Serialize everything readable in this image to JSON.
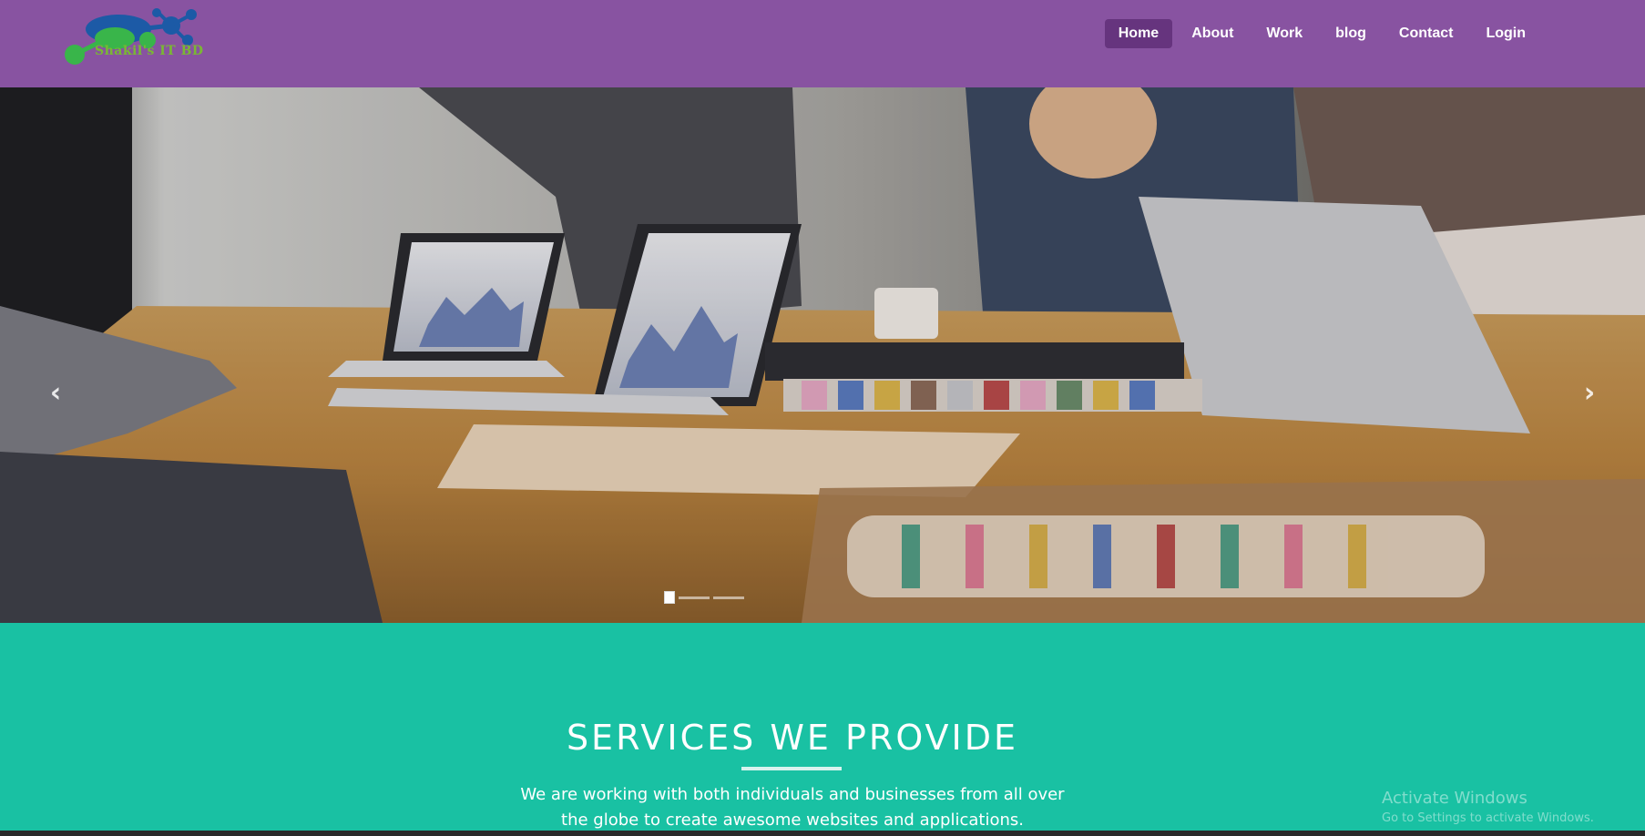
{
  "brand": {
    "logo_text": "Shakil's IT BD"
  },
  "nav": {
    "items": [
      {
        "label": "Home",
        "active": true
      },
      {
        "label": "About",
        "active": false
      },
      {
        "label": "Work",
        "active": false
      },
      {
        "label": "blog",
        "active": false
      },
      {
        "label": "Contact",
        "active": false
      },
      {
        "label": "Login",
        "active": false
      }
    ]
  },
  "carousel": {
    "prev_icon": "chevron-left-icon",
    "next_icon": "chevron-right-icon",
    "slide_count": 3,
    "active_slide": 1
  },
  "services": {
    "title": "SERVICES WE PROVIDE",
    "description": "We are working with both individuals and businesses from all over the globe to create awesome websites and applications."
  },
  "watermark": {
    "line1": "Activate Windows",
    "line2": "Go to Settings to activate Windows."
  },
  "colors": {
    "header_bg": "#8853a1",
    "nav_active_bg": "#66347e",
    "services_bg": "#19c1a3"
  }
}
